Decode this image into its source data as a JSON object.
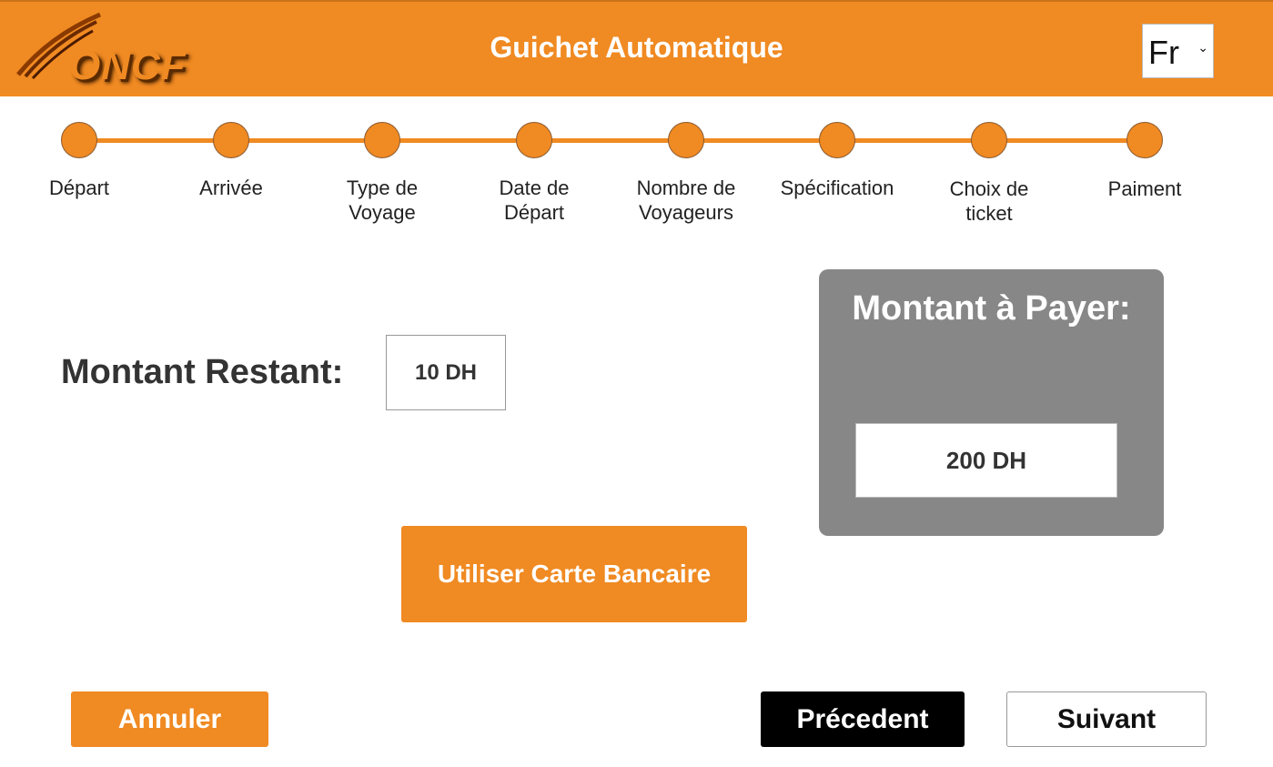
{
  "header": {
    "logo_text": "ONCF",
    "title": "Guichet Automatique",
    "language": {
      "selected": "Fr"
    }
  },
  "steps": [
    {
      "label_lines": [
        "Départ"
      ]
    },
    {
      "label_lines": [
        "Arrivée"
      ]
    },
    {
      "label_lines": [
        "Type de",
        "Voyage"
      ]
    },
    {
      "label_lines": [
        "Date de",
        "Départ"
      ]
    },
    {
      "label_lines": [
        "Nombre de",
        "Voyageurs"
      ]
    },
    {
      "label_lines": [
        "Spécification"
      ]
    },
    {
      "label_lines": [
        "Choix de",
        "ticket"
      ]
    },
    {
      "label_lines": [
        "Paiment"
      ]
    }
  ],
  "payment": {
    "remaining_label": "Montant Restant:",
    "remaining_value": "10 DH",
    "to_pay_label": "Montant à Payer:",
    "to_pay_value": "200 DH",
    "card_button": "Utiliser Carte Bancaire"
  },
  "footer": {
    "cancel_label": "Annuler",
    "previous_label": "Précedent",
    "next_label": "Suivant"
  },
  "colors": {
    "accent": "#f08a22",
    "panel": "#878787"
  }
}
